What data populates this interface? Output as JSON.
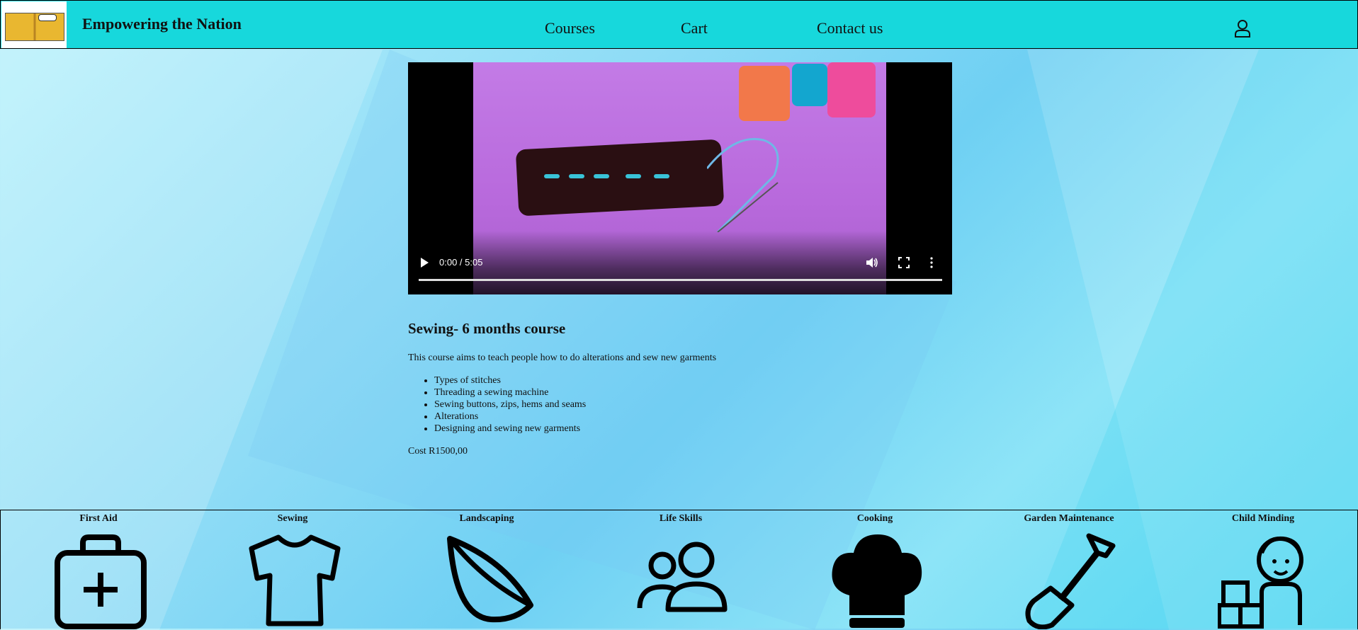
{
  "header": {
    "site_title": "Empowering the Nation",
    "nav": [
      {
        "label": "Courses"
      },
      {
        "label": "Cart"
      },
      {
        "label": "Contact us"
      }
    ]
  },
  "video": {
    "time": "0:00 / 5:05",
    "progress": 0
  },
  "course": {
    "title": "Sewing- 6 months course",
    "description": "This course aims to teach people how to do alterations and sew new garments",
    "topics": [
      "Types of stitches",
      "Threading a sewing machine",
      "Sewing buttons, zips, hems and seams",
      "Alterations",
      "Designing and sewing new garments"
    ],
    "cost": "Cost R1500,00"
  },
  "categories": [
    {
      "label": "First Aid",
      "icon": "first-aid-kit-icon"
    },
    {
      "label": "Sewing",
      "icon": "shirt-icon"
    },
    {
      "label": "Landscaping",
      "icon": "leaf-icon"
    },
    {
      "label": "Life Skills",
      "icon": "people-icon"
    },
    {
      "label": "Cooking",
      "icon": "chef-hat-icon"
    },
    {
      "label": "Garden Maintenance",
      "icon": "shovel-icon"
    },
    {
      "label": "Child Minding",
      "icon": "child-with-blocks-icon"
    }
  ],
  "colors": {
    "header_bg": "#17d8dc",
    "page_bg": "#8fdcf6"
  }
}
